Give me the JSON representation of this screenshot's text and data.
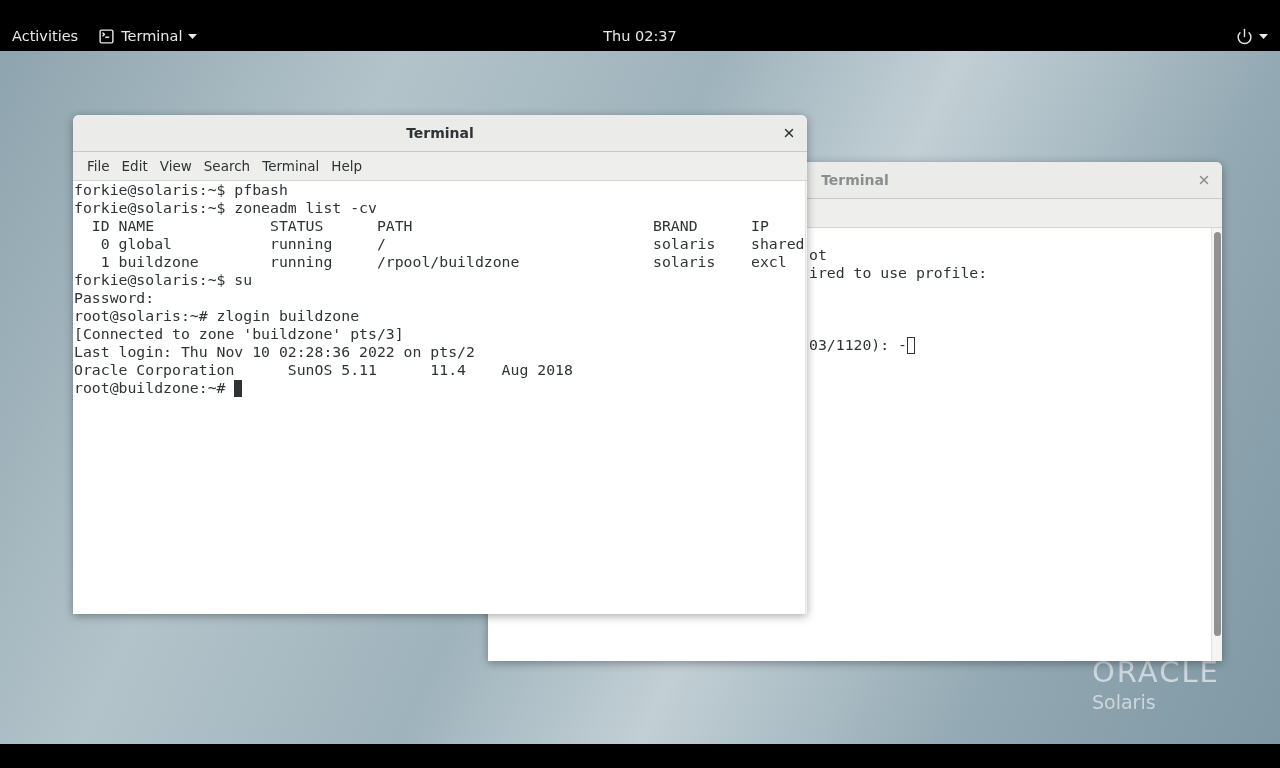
{
  "top_bar": {
    "activities": "Activities",
    "app_menu": "Terminal",
    "clock": "Thu 02:37"
  },
  "windows": [
    {
      "title": "Terminal",
      "focused": true,
      "menu": [
        "File",
        "Edit",
        "View",
        "Search",
        "Terminal",
        "Help"
      ],
      "lines": [
        {
          "kind": "text",
          "text": "forkie@solaris:~$ pfbash",
          "cursor": false
        },
        {
          "kind": "text",
          "text": "forkie@solaris:~$ zoneadm list -cv",
          "cursor": false
        },
        {
          "kind": "text",
          "text": "  ID NAME             STATUS      PATH                           BRAND      IP",
          "cursor": false
        },
        {
          "kind": "text",
          "text": "   0 global           running     /                              solaris    shared",
          "cursor": false
        },
        {
          "kind": "text",
          "text": "   1 buildzone        running     /rpool/buildzone               solaris    excl",
          "cursor": false
        },
        {
          "kind": "text",
          "text": "forkie@solaris:~$ su",
          "cursor": false
        },
        {
          "kind": "text",
          "text": "Password:",
          "cursor": false
        },
        {
          "kind": "text",
          "text": "root@solaris:~# zlogin buildzone",
          "cursor": false
        },
        {
          "kind": "text",
          "text": "[Connected to zone 'buildzone' pts/3]",
          "cursor": false
        },
        {
          "kind": "text",
          "text": "Last login: Thu Nov 10 02:28:36 2022 on pts/2",
          "cursor": false
        },
        {
          "kind": "text",
          "text": "Oracle Corporation      SunOS 5.11      11.4    Aug 2018",
          "cursor": false
        },
        {
          "kind": "text",
          "text": "root@buildzone:~# ",
          "cursor": true
        }
      ]
    },
    {
      "title": "Terminal",
      "focused": false,
      "lines": [
        {
          "kind": "blank"
        },
        {
          "kind": "text",
          "text": "ot",
          "cursor": false
        },
        {
          "kind": "text",
          "text": "ired to use profile:",
          "cursor": false
        },
        {
          "kind": "blank"
        },
        {
          "kind": "blank"
        },
        {
          "kind": "blank"
        },
        {
          "kind": "text",
          "text": "03/1120): -",
          "cursor": true
        }
      ]
    }
  ],
  "wallpaper_logo": {
    "brand": "ORACLE",
    "product": "Solaris"
  }
}
